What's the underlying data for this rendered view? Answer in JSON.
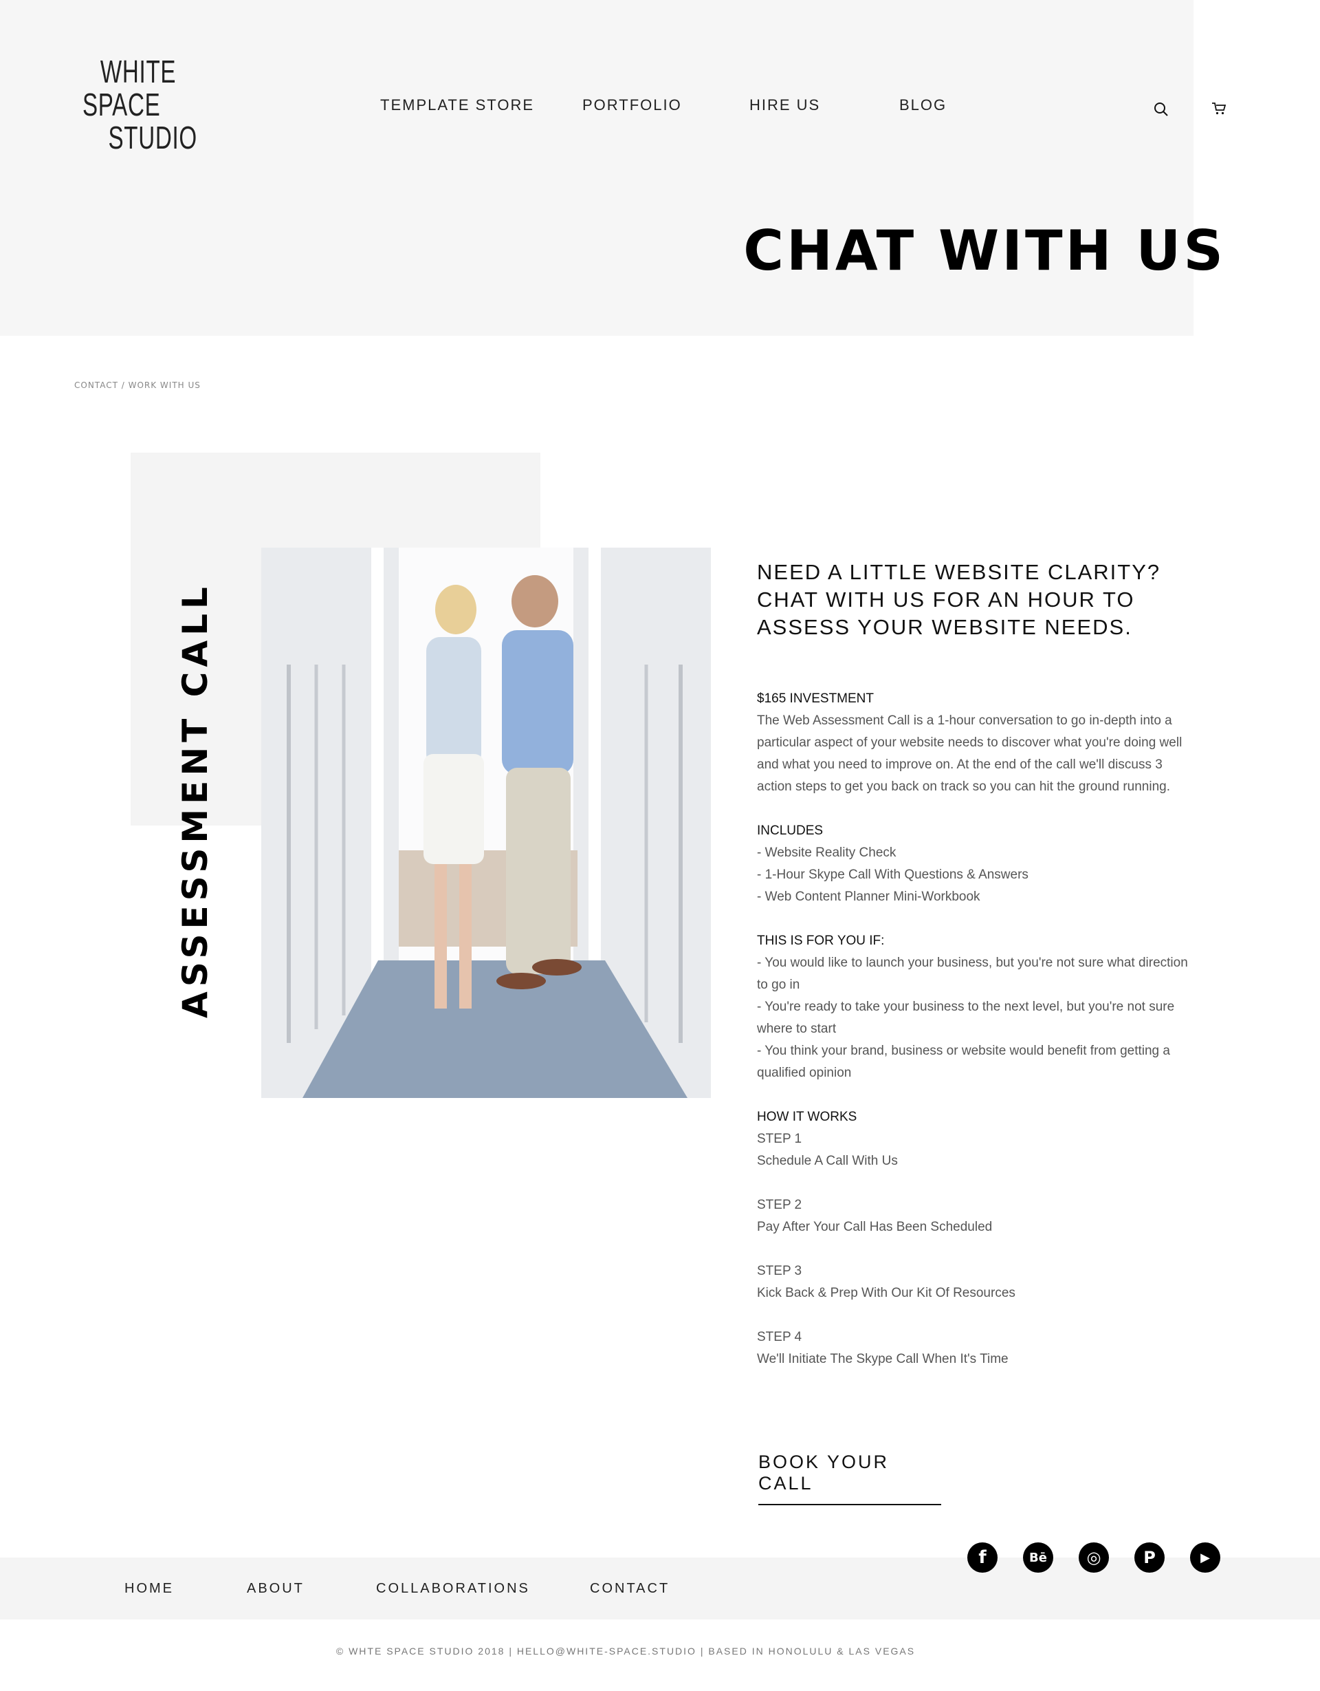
{
  "header": {
    "logo_lines": [
      "WHITE",
      "SPACE",
      "STUDIO"
    ],
    "nav": [
      "TEMPLATE STORE",
      "PORTFOLIO",
      "HIRE US",
      "BLOG"
    ],
    "icons": [
      "search-icon",
      "cart-icon"
    ]
  },
  "hero": {
    "title": "CHAT WITH US"
  },
  "breadcrumb": "CONTACT / WORK WITH US",
  "feature": {
    "vertical_title": "ASSESSMENT CALL",
    "intro": "NEED A LITTLE WEBSITE CLARITY? CHAT WITH US FOR AN HOUR TO ASSESS YOUR WEBSITE NEEDS.",
    "investment_heading": "$165 INVESTMENT",
    "investment_text": "The Web Assessment Call is a 1-hour conversation to go in-depth into a particular aspect of your website needs to discover what you're doing well and what you need to improve on. At the end of the call we'll discuss 3 action steps to get you back on track so you can hit the ground running.",
    "includes_heading": "INCLUDES",
    "includes": [
      "- Website Reality Check",
      "- 1-Hour Skype Call With Questions & Answers",
      "- Web Content Planner Mini-Workbook"
    ],
    "for_you_heading": "THIS IS FOR YOU IF:",
    "for_you": [
      "- You would like to launch your business, but you're not sure what direction to go in",
      "- You're ready to take your business to the next level, but you're not sure where to start",
      "- You think your brand, business or website would benefit from getting a qualified opinion"
    ],
    "how_heading": "HOW IT WORKS",
    "steps": [
      {
        "label": "STEP 1",
        "text": "Schedule A Call With Us"
      },
      {
        "label": "STEP 2",
        "text": "Pay After Your Call Has Been Scheduled"
      },
      {
        "label": "STEP 3",
        "text": "Kick Back & Prep With Our Kit Of Resources"
      },
      {
        "label": "STEP 4",
        "text": "We'll Initiate The Skype Call When It's Time"
      }
    ],
    "cta": "BOOK YOUR CALL"
  },
  "footer": {
    "nav": [
      "HOME",
      "ABOUT",
      "COLLABORATIONS",
      "CONTACT"
    ],
    "social": [
      {
        "icon": "facebook-icon",
        "glyph": "f"
      },
      {
        "icon": "behance-icon",
        "glyph": "Bē"
      },
      {
        "icon": "instagram-icon",
        "glyph": "◎"
      },
      {
        "icon": "pinterest-icon",
        "glyph": "P"
      },
      {
        "icon": "youtube-icon",
        "glyph": "▶"
      }
    ],
    "copyright": "© WHTE SPACE STUDIO 2018 |  HELLO@WHITE-SPACE.STUDIO |   BASED IN HONOLULU & LAS VEGAS"
  }
}
